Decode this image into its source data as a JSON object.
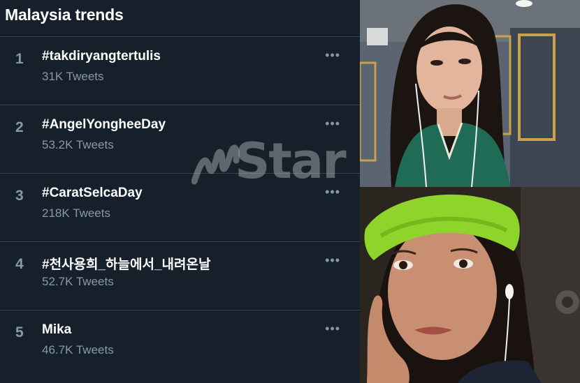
{
  "trends": {
    "title": "Malaysia trends",
    "items": [
      {
        "rank": "1",
        "name": "#takdiryangtertulis",
        "count": "31K Tweets"
      },
      {
        "rank": "2",
        "name": "#AngelYongheeDay",
        "count": "53.2K Tweets"
      },
      {
        "rank": "3",
        "name": "#CaratSelcaDay",
        "count": "218K Tweets"
      },
      {
        "rank": "4",
        "name": "#천사용희_하늘에서_내려온날",
        "count": "52.7K Tweets"
      },
      {
        "rank": "5",
        "name": "Mika",
        "count": "46.7K Tweets"
      }
    ],
    "more_icon": "more-horizontal-icon"
  },
  "watermark": {
    "text": "Star",
    "logo": "mStar"
  },
  "video_call": {
    "top_participant_image": "woman-in-green-pajamas",
    "bottom_participant_image": "woman-with-green-headband"
  },
  "colors": {
    "background": "#15202b",
    "divider": "#38444d",
    "secondary_text": "#8899a6",
    "primary_text": "#ffffff"
  }
}
